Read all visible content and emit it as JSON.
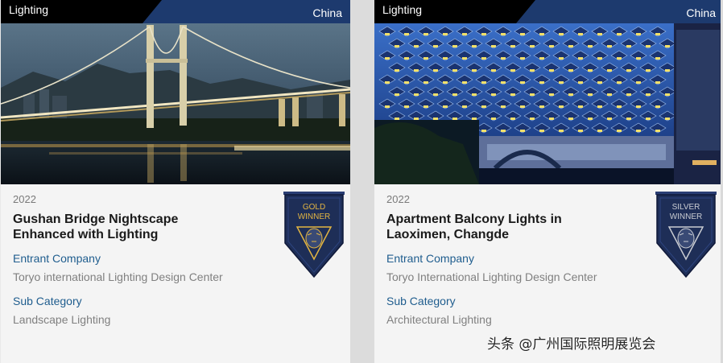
{
  "cards": [
    {
      "category": "Lighting",
      "country": "China",
      "image_alt": "suspension-bridge-night-photo",
      "year": "2022",
      "title": "Gushan Bridge Nightscape Enhanced with Lighting",
      "entrant_label": "Entrant Company",
      "entrant": "Toryo international Lighting Design Center",
      "subcategory_label": "Sub Category",
      "subcategory": "Landscape Lighting",
      "award": {
        "line1": "GOLD",
        "line2": "WINNER",
        "color": "#e3b542"
      }
    },
    {
      "category": "Lighting",
      "country": "China",
      "image_alt": "apartment-balcony-lights-photo",
      "year": "2022",
      "title": "Apartment Balcony Lights in Laoximen, Changde",
      "entrant_label": "Entrant Company",
      "entrant": "Toryo International Lighting Design Center",
      "subcategory_label": "Sub Category",
      "subcategory": "Architectural Lighting",
      "award": {
        "line1": "SILVER",
        "line2": "WINNER",
        "color": "#c9ccd2"
      }
    }
  ],
  "watermark": "头条 @广州国际照明展览会",
  "colors": {
    "header": "#000000",
    "country_band": "#1d3a6e",
    "label": "#1f5d8e",
    "value": "#808080",
    "badge_bg": "#1e2e57"
  }
}
